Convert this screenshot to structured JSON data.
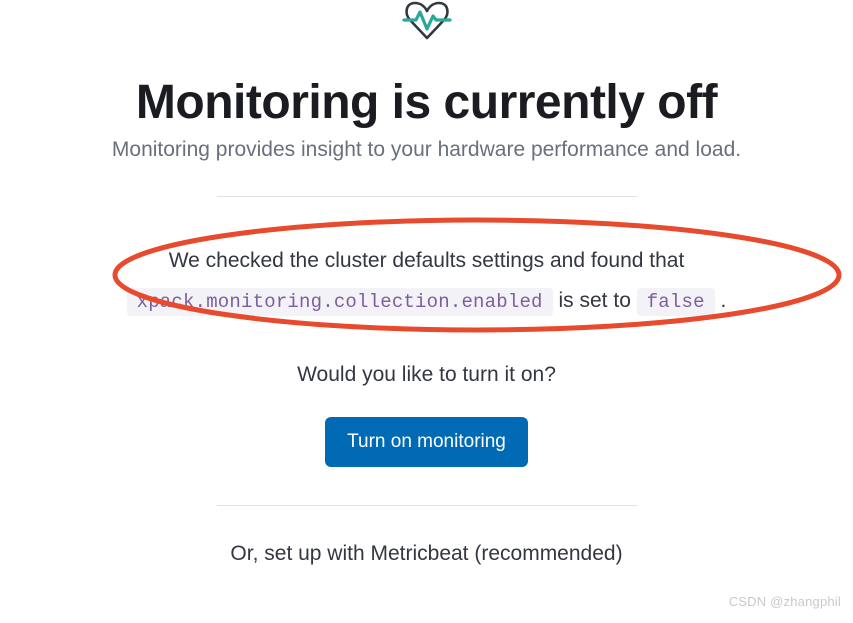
{
  "icon": {
    "name": "heartbeat-monitor-icon",
    "accent": "#2aa89a",
    "stroke": "#343741"
  },
  "title": "Monitoring is currently off",
  "subtitle": "Monitoring provides insight to your hardware performance and load.",
  "check": {
    "prefix": "We checked the cluster defaults settings and found that",
    "setting_key": "xpack.monitoring.collection.enabled",
    "mid": " is set to ",
    "setting_value": "false",
    "suffix": " ."
  },
  "prompt": "Would you like to turn it on?",
  "button": {
    "label": "Turn on monitoring"
  },
  "alternative": "Or, set up with Metricbeat (recommended)",
  "annotation": {
    "color": "#e84a2e"
  },
  "watermark": "CSDN @zhangphil"
}
